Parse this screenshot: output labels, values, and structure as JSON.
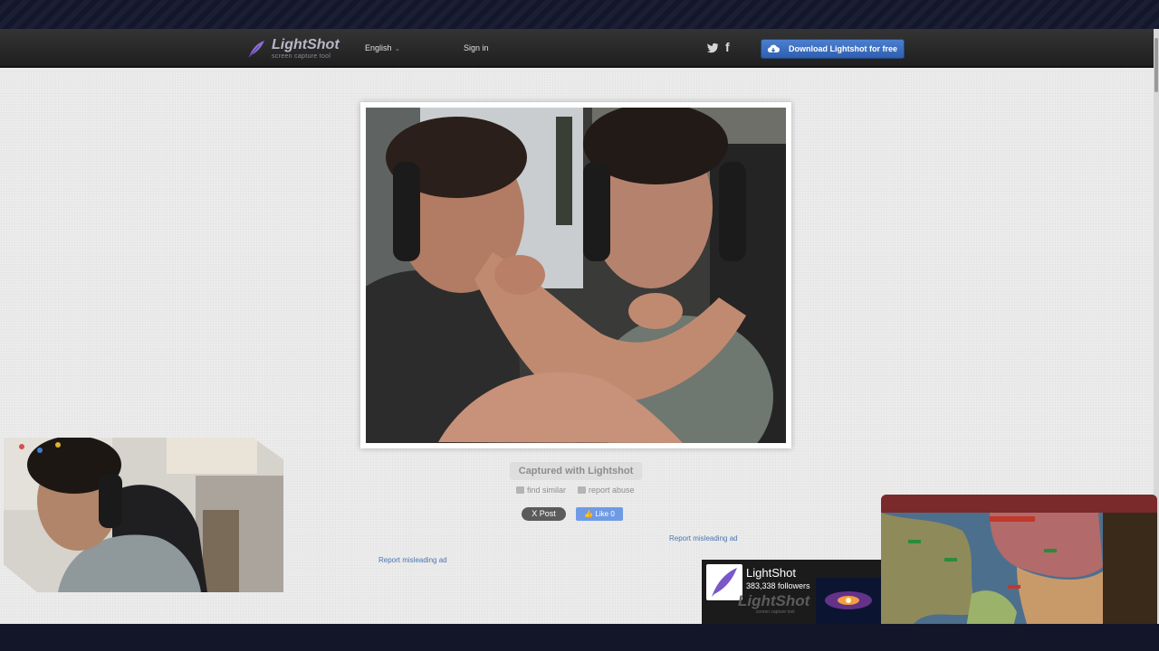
{
  "header": {
    "brand": "LightShot",
    "tagline": "screen capture tool",
    "language": "English",
    "signin": "Sign in",
    "download_label": "Download Lightshot for free"
  },
  "main": {
    "captured": "Captured with Lightshot",
    "find_similar": "find similar",
    "report_abuse": "report abuse",
    "x_post": "X Post",
    "like": "Like 0",
    "report_ad_1": "Report misleading ad",
    "report_ad_2": "Report misleading ad"
  },
  "promo": {
    "title": "LightShot",
    "followers": "383,338 followers",
    "logo_text": "LightShot",
    "logo_tag": "screen capture tool"
  },
  "colors": {
    "header_bg": "#2a2a2a",
    "accent": "#3b6cc4",
    "link": "#4a74b0",
    "page_bg": "#ececec"
  },
  "icons": [
    "feather-icon",
    "twitter-icon",
    "facebook-icon",
    "download-cloud-icon",
    "search-icon",
    "flag-icon",
    "thumbs-up-icon"
  ]
}
